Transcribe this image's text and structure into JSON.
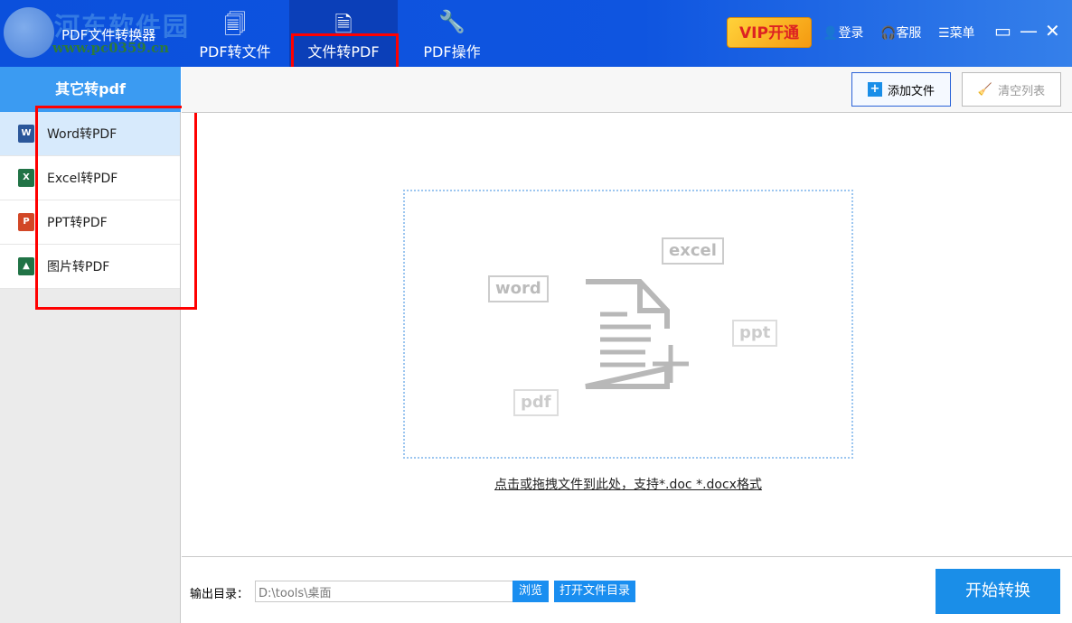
{
  "watermark": {
    "name": "河东软件园",
    "url": "www.pc0359.cn"
  },
  "app": {
    "title": "PDF文件转换器"
  },
  "tabs": [
    {
      "label": "PDF转文件",
      "icon": "pdf-to-file-icon"
    },
    {
      "label": "文件转PDF",
      "icon": "file-to-pdf-icon",
      "active": true
    },
    {
      "label": "PDF操作",
      "icon": "wrench-icon"
    }
  ],
  "header": {
    "vip": "VIP开通",
    "login": "登录",
    "service": "客服",
    "menu": "菜单"
  },
  "sidebar": {
    "title": "其它转pdf",
    "items": [
      {
        "label": "Word转PDF",
        "icon": "W",
        "color": "#2b579a",
        "selected": true
      },
      {
        "label": "Excel转PDF",
        "icon": "X",
        "color": "#217346"
      },
      {
        "label": "PPT转PDF",
        "icon": "P",
        "color": "#d24726"
      },
      {
        "label": "图片转PDF",
        "icon": "▲",
        "color": "#217346"
      }
    ]
  },
  "toolbar": {
    "add": "添加文件",
    "clear": "清空列表"
  },
  "dropzone": {
    "tags": [
      "word",
      "excel",
      "ppt",
      "pdf"
    ],
    "hint": "点击或拖拽文件到此处，支持*.doc *.docx格式"
  },
  "bottom": {
    "label": "输出目录：",
    "path": "D:\\tools\\桌面",
    "browse": "浏览",
    "open": "打开文件目录",
    "start": "开始转换"
  },
  "colors": {
    "header": "#0f55e0",
    "accent": "#1a8ee8",
    "annotation": "#ff0000"
  }
}
